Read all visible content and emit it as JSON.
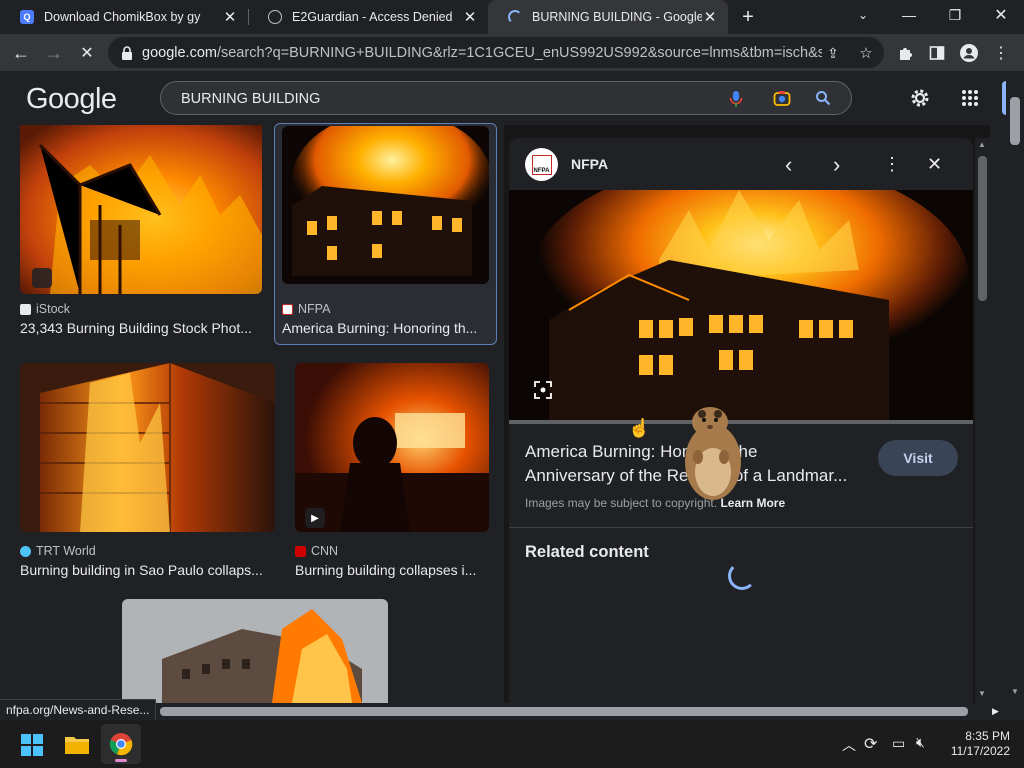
{
  "tabs": [
    {
      "title": "Download ChomikBox by gy",
      "icon": "q-favicon"
    },
    {
      "title": "E2Guardian - Access Denied",
      "icon": "globe-icon"
    },
    {
      "title": "BURNING BUILDING - Google Se",
      "icon": "loading-spinner-icon"
    }
  ],
  "toolbar": {
    "url_host": "google.com",
    "url_path": "/search?q=BURNING+BUILDING&rlz=1C1GCEU_enUS992US992&source=lnms&tbm=isch&sa..."
  },
  "google": {
    "logo": "Google",
    "query": "BURNING BUILDING"
  },
  "results": [
    {
      "source": "iStock",
      "title": "23,343 Burning Building Stock Phot..."
    },
    {
      "source": "NFPA",
      "title": "America Burning: Honoring th..."
    },
    {
      "source": "TRT World",
      "title": "Burning building in Sao Paulo collaps..."
    },
    {
      "source": "CNN",
      "title": "Burning building collapses i..."
    }
  ],
  "panel": {
    "source": "NFPA",
    "logo_text": "NFPA",
    "title_line1": "America Burning: Honoring the",
    "title_line2": "Anniversary of the Release of a Landmar...",
    "visit_label": "Visit",
    "copyright": "Images may be subject to copyright.",
    "learn_more": "Learn More",
    "related": "Related content"
  },
  "status_url": "nfpa.org/News-and-Rese...",
  "taskbar": {
    "time": "8:35 PM",
    "date": "11/17/2022"
  },
  "colors": {
    "accent_blue": "#8ab4f8",
    "panel_bg": "#202124",
    "fire_orange": "#ff8a00"
  }
}
